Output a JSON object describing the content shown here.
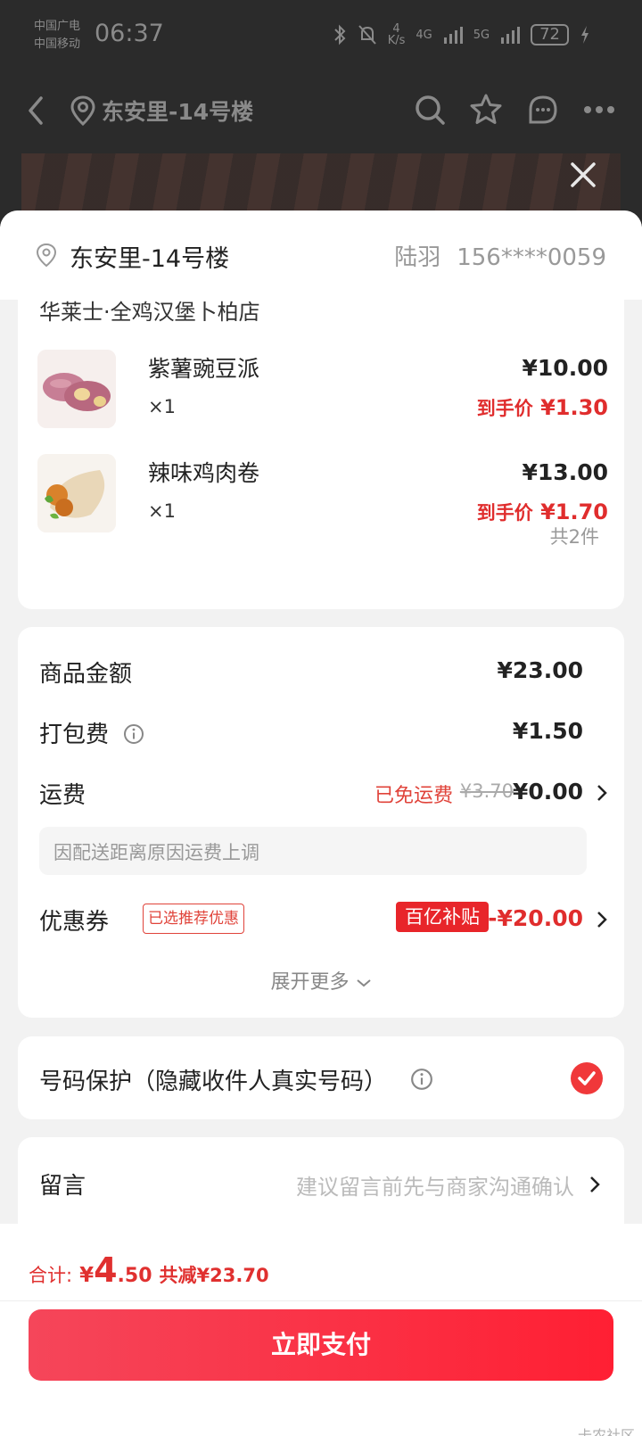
{
  "status_bar": {
    "carrier_1": "中国广电",
    "carrier_2": "中国移动",
    "time": "06:37",
    "net_speed_value": "4",
    "net_speed_unit": "K/s",
    "net_4g": "4G",
    "net_5g": "5G",
    "battery": "72"
  },
  "nav": {
    "title": "东安里-14号楼"
  },
  "address": {
    "name": "东安里-14号楼",
    "recipient": "陆羽",
    "phone": "156****0059"
  },
  "order": {
    "store_name": "华莱士·全鸡汉堡卜柏店",
    "items": [
      {
        "name": "紫薯豌豆派",
        "qty": "×1",
        "price": "¥10.00",
        "final_label": "到手价",
        "final_price": "¥1.30"
      },
      {
        "name": "辣味鸡肉卷",
        "qty": "×1",
        "price": "¥13.00",
        "final_label": "到手价",
        "final_price": "¥1.70"
      }
    ],
    "total_count": "共2件"
  },
  "fees": {
    "goods_label": "商品金额",
    "goods_value": "¥23.00",
    "packing_label": "打包费",
    "packing_value": "¥1.50",
    "shipping_label": "运费",
    "shipping_free_text": "已免运费",
    "shipping_old_price": "¥3.70",
    "shipping_value": "¥0.00",
    "shipping_note": "因配送距离原因运费上调",
    "coupon_label": "优惠券",
    "coupon_tag": "已选推荐优惠",
    "coupon_badge": "百亿补贴",
    "coupon_value": "-¥20.00",
    "expand_text": "展开更多"
  },
  "privacy": {
    "label": "号码保护（隐藏收件人真实号码）",
    "checked": true
  },
  "message": {
    "label": "留言",
    "placeholder": "建议留言前先与商家沟通确认"
  },
  "bottom": {
    "sum_label": "合计:",
    "sum_currency": "¥",
    "sum_integer": "4",
    "sum_decimal": ".50",
    "saved_text": "共减¥23.70",
    "pay_button": "立即支付",
    "watermark": "卡农社区"
  },
  "colors": {
    "accent_red": "#e02d2d",
    "pay_gradient_start": "#f5465a",
    "pay_gradient_end": "#ff1f33",
    "badge_red": "#e8252a"
  }
}
